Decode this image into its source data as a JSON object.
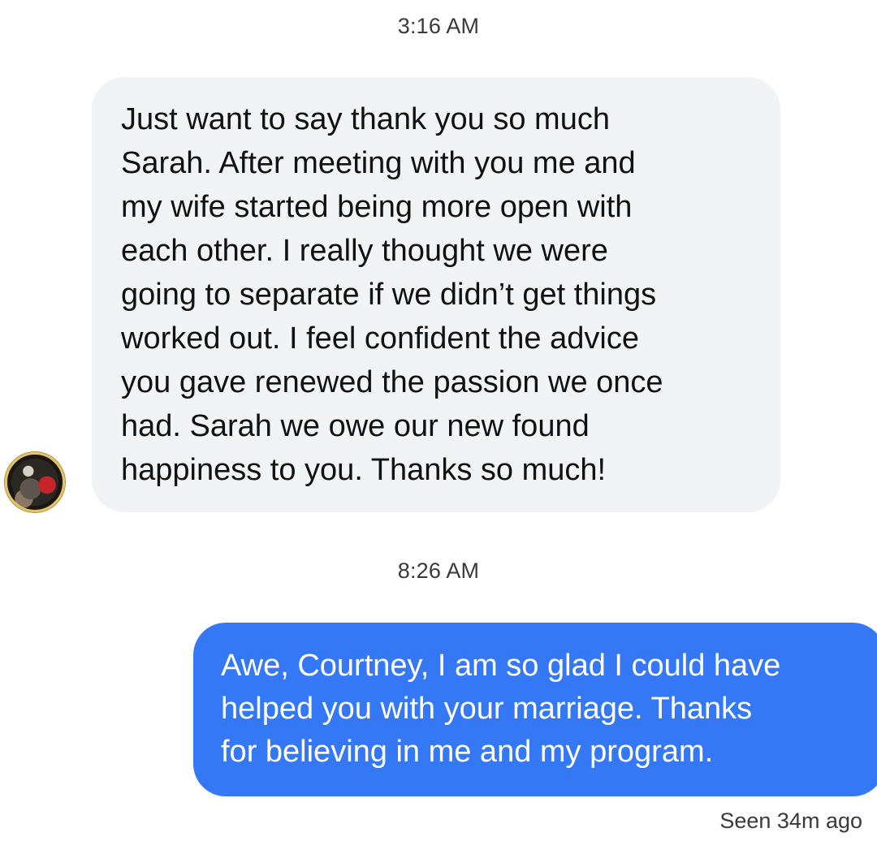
{
  "conversation": {
    "messages": [
      {
        "timestamp": "3:16 AM",
        "direction": "incoming",
        "text": "Just want to say thank you so much\nSarah. After meeting with you me and\nmy wife started being more open with\neach other. I really thought we were\ngoing to separate if we didn’t get things\nworked out. I feel confident the advice\nyou gave renewed the passion we once\nhad. Sarah we owe our new found\nhappiness to you. Thanks so much!"
      },
      {
        "timestamp": "8:26 AM",
        "direction": "outgoing",
        "text": "Awe, Courtney, I am so glad I could have\nhelped you with your marriage.  Thanks\nfor believing in me and my program."
      }
    ],
    "seen_status": "Seen 34m ago"
  },
  "colors": {
    "incoming_bubble": "#f2f3f6",
    "outgoing_bubble": "#3478f6",
    "avatar_ring": "#e2c36a"
  },
  "icons": {
    "avatar": "sender-avatar"
  }
}
